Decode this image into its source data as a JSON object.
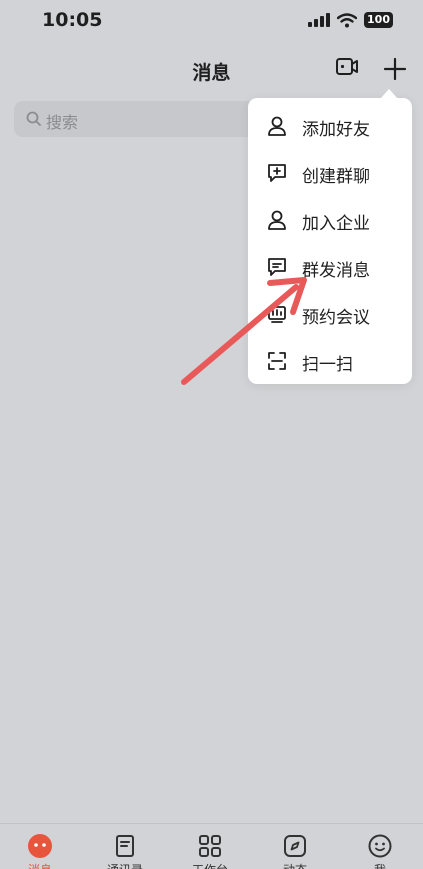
{
  "status_bar": {
    "time": "10:05",
    "battery": "100"
  },
  "header": {
    "title": "消息"
  },
  "search": {
    "placeholder": "搜索"
  },
  "menu": {
    "items": [
      {
        "label": "添加好友",
        "icon": "person-icon"
      },
      {
        "label": "创建群聊",
        "icon": "chat-plus-icon"
      },
      {
        "label": "加入企业",
        "icon": "person-icon"
      },
      {
        "label": "群发消息",
        "icon": "message-icon"
      },
      {
        "label": "预约会议",
        "icon": "meeting-icon"
      },
      {
        "label": "扫一扫",
        "icon": "scan-icon"
      }
    ]
  },
  "tab_bar": {
    "tabs": [
      {
        "label": "消息",
        "icon": "message-face-icon",
        "active": true
      },
      {
        "label": "通讯录",
        "icon": "contacts-icon"
      },
      {
        "label": "工作台",
        "icon": "workbench-icon"
      },
      {
        "label": "动态",
        "icon": "compass-icon"
      },
      {
        "label": "我",
        "icon": "smile-icon"
      }
    ]
  },
  "colors": {
    "accent": "#e8553d",
    "annotation_arrow": "#e85a5a",
    "overlay_bg": "#d2d3d6"
  }
}
